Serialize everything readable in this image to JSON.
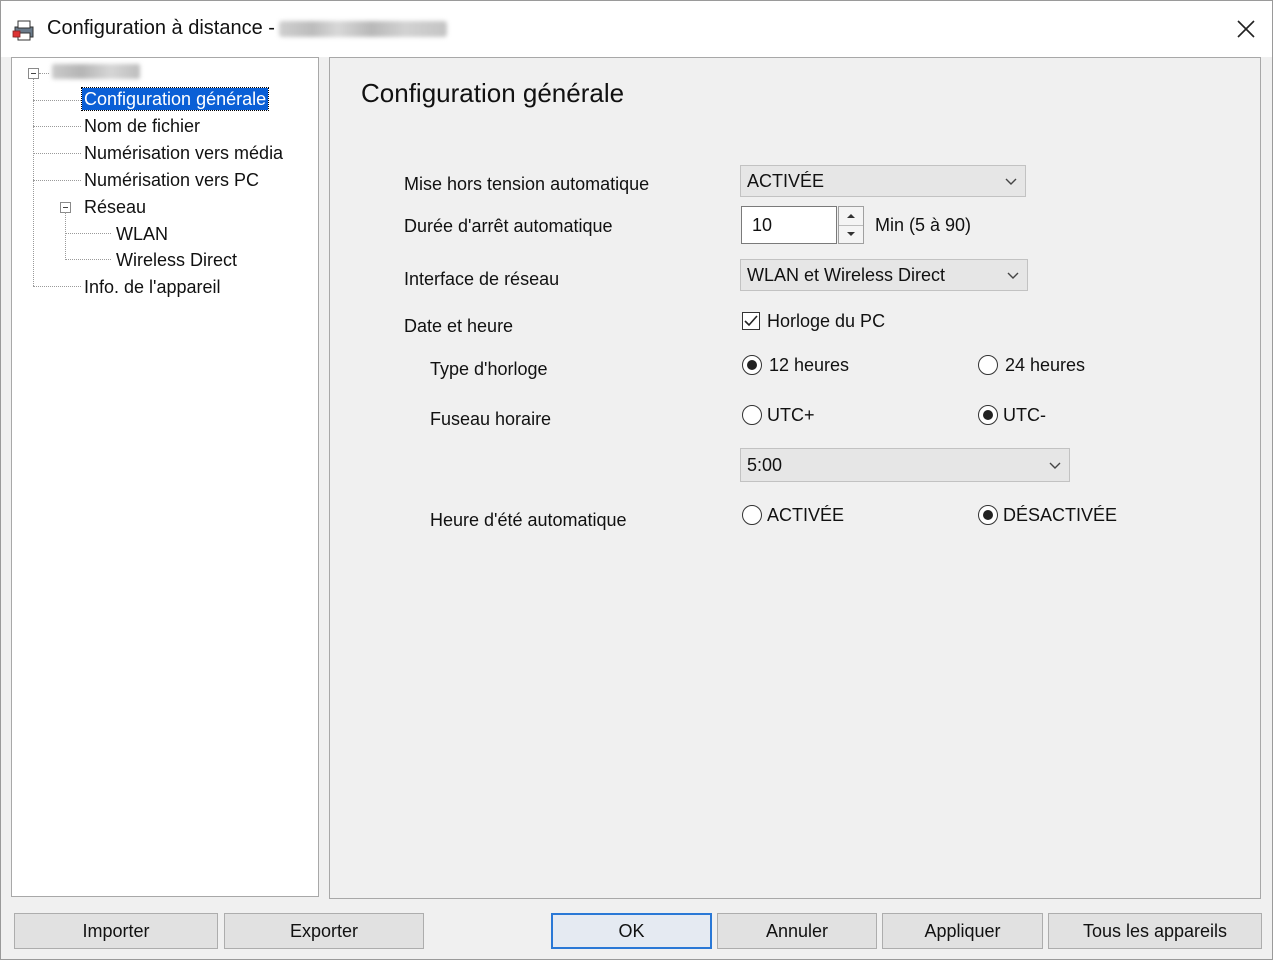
{
  "window": {
    "title": "Configuration à distance -"
  },
  "tree": {
    "items": [
      "Configuration générale",
      "Nom de fichier",
      "Numérisation vers média",
      "Numérisation vers PC",
      "Réseau",
      "WLAN",
      "Wireless Direct",
      "Info. de l'appareil"
    ]
  },
  "main": {
    "title": "Configuration générale",
    "auto_power_off": {
      "label": "Mise hors tension automatique",
      "value": "ACTIVÉE"
    },
    "auto_off_time": {
      "label": "Durée d'arrêt automatique",
      "value": "10",
      "unit": "Min (5 à 90)"
    },
    "network_interface": {
      "label": "Interface de réseau",
      "value": "WLAN et Wireless Direct"
    },
    "date_time": {
      "label": "Date et heure",
      "pc_clock_label": "Horloge du PC",
      "pc_clock_checked": true
    },
    "clock_type": {
      "label": "Type d'horloge",
      "option_12": "12 heures",
      "option_24": "24 heures",
      "selected": "12 heures"
    },
    "time_zone": {
      "label": "Fuseau horaire",
      "option_plus": "UTC+",
      "option_minus": "UTC-",
      "selected": "UTC-",
      "offset_value": "5:00"
    },
    "dst": {
      "label": "Heure d'été automatique",
      "option_on": "ACTIVÉE",
      "option_off": "DÉSACTIVÉE",
      "selected": "DÉSACTIVÉE"
    }
  },
  "buttons": {
    "import": "Importer",
    "export": "Exporter",
    "ok": "OK",
    "cancel": "Annuler",
    "apply": "Appliquer",
    "all_devices": "Tous les appareils"
  },
  "colors": {
    "selection": "#0a5fd6",
    "default_button_border": "#2a78d6"
  }
}
